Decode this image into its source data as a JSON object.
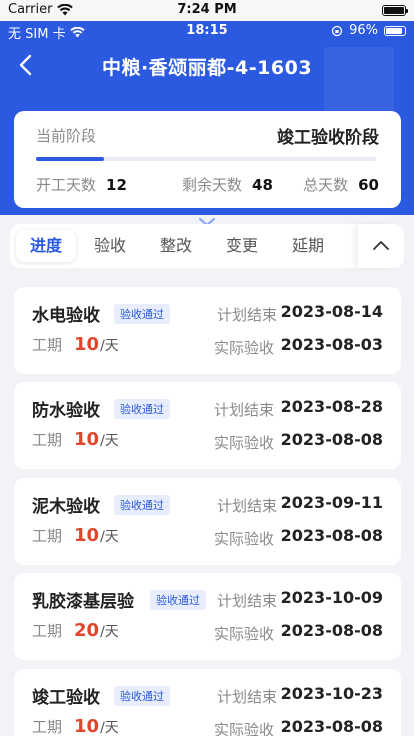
{
  "sim_status": {
    "carrier": "Carrier",
    "time": "7:24 PM"
  },
  "status": {
    "sim": "无 SIM 卡",
    "time": "18:15",
    "battery": "96%"
  },
  "nav": {
    "title": "中粮·香颂丽都-4-1603"
  },
  "stage": {
    "current_label": "当前阶段",
    "current_value": "竣工验收阶段",
    "progress": 0.2,
    "start_label": "开工天数",
    "start_value": "12",
    "remain_label": "剩余天数",
    "remain_value": "48",
    "total_label": "总天数",
    "total_value": "60"
  },
  "tabs": [
    {
      "label": "进度",
      "active": true
    },
    {
      "label": "验收",
      "active": false
    },
    {
      "label": "整改",
      "active": false
    },
    {
      "label": "变更",
      "active": false
    },
    {
      "label": "延期",
      "active": false
    }
  ],
  "labels": {
    "duration": "工期",
    "unit": "/天",
    "plan_end": "计划结束",
    "actual": "实际验收"
  },
  "items": [
    {
      "name": "水电验收",
      "badge": "验收通过",
      "days": "10",
      "plan_end": "2023-08-14",
      "actual": "2023-08-03"
    },
    {
      "name": "防水验收",
      "badge": "验收通过",
      "days": "10",
      "plan_end": "2023-08-28",
      "actual": "2023-08-08"
    },
    {
      "name": "泥木验收",
      "badge": "验收通过",
      "days": "10",
      "plan_end": "2023-09-11",
      "actual": "2023-08-08"
    },
    {
      "name": "乳胶漆基层验",
      "badge": "验收通过",
      "days": "20",
      "plan_end": "2023-10-09",
      "actual": "2023-08-08"
    },
    {
      "name": "竣工验收",
      "badge": "验收通过",
      "days": "10",
      "plan_end": "2023-10-23",
      "actual": "2023-08-08"
    }
  ],
  "colors": {
    "primary": "#2b59e0",
    "accent_red": "#e1462d",
    "badge_bg": "#e7edfc"
  }
}
